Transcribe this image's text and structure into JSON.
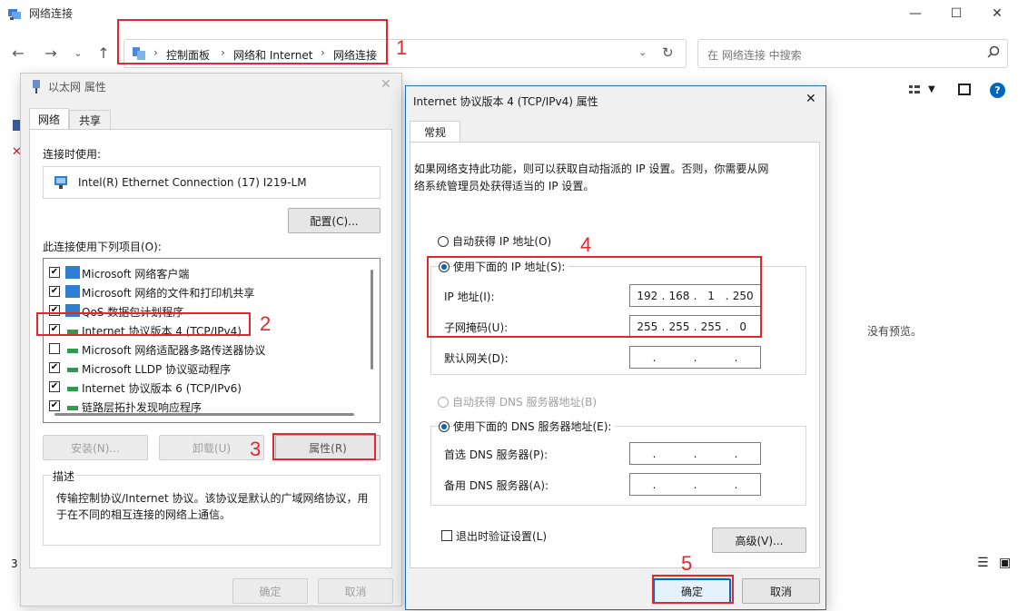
{
  "explorer": {
    "title": "网络连接",
    "controls": {
      "minimize": "—",
      "maximize": "☐",
      "close": "✕"
    },
    "breadcrumb": [
      "控制面板",
      "网络和 Internet",
      "网络连接"
    ],
    "search_placeholder": "在 网络连接 中搜索",
    "no_preview": "没有预览。",
    "status_count": "3"
  },
  "annotations": {
    "n1": "1",
    "n2": "2",
    "n3": "3",
    "n4": "4",
    "n5": "5",
    "color": "#e5262b"
  },
  "eth": {
    "title": "以太网 属性",
    "tabs": [
      "网络",
      "共享"
    ],
    "connect_using_label": "连接时使用:",
    "adapter": "Intel(R) Ethernet Connection (17) I219-LM",
    "configure": "配置(C)...",
    "items_label": "此连接使用下列项目(O):",
    "items": [
      {
        "label": "Microsoft 网络客户端",
        "checked": "✔"
      },
      {
        "label": "Microsoft 网络的文件和打印机共享",
        "checked": "✔"
      },
      {
        "label": "QoS 数据包计划程序",
        "checked": "✔"
      },
      {
        "label": "Internet 协议版本 4 (TCP/IPv4)",
        "checked": "✔"
      },
      {
        "label": "Microsoft 网络适配器多路传送器协议",
        "checked": ""
      },
      {
        "label": "Microsoft LLDP 协议驱动程序",
        "checked": "✔"
      },
      {
        "label": "Internet 协议版本 6 (TCP/IPv6)",
        "checked": "✔"
      },
      {
        "label": "链路层拓扑发现响应程序",
        "checked": "✔"
      }
    ],
    "install": "安装(N)...",
    "uninstall": "卸载(U)",
    "properties": "属性(R)",
    "desc_label": "描述",
    "desc_text": "传输控制协议/Internet 协议。该协议是默认的广域网络协议，用于在不同的相互连接的网络上通信。",
    "ok": "确定",
    "cancel": "取消"
  },
  "ipv4": {
    "title": "Internet 协议版本 4 (TCP/IPv4) 属性",
    "tab": "常规",
    "intro": "如果网络支持此功能，则可以获取自动指派的 IP 设置。否则，你需要从网络系统管理员处获得适当的 IP 设置。",
    "auto_ip": "自动获得 IP 地址(O)",
    "manual_ip": "使用下面的 IP 地址(S):",
    "ip_label": "IP 地址(I):",
    "ip_value": [
      "192",
      "168",
      "1",
      "250"
    ],
    "mask_label": "子网掩码(U):",
    "mask_value": [
      "255",
      "255",
      "255",
      "0"
    ],
    "gateway_label": "默认网关(D):",
    "auto_dns": "自动获得 DNS 服务器地址(B)",
    "manual_dns": "使用下面的 DNS 服务器地址(E):",
    "pref_dns_label": "首选 DNS 服务器(P):",
    "alt_dns_label": "备用 DNS 服务器(A):",
    "validate": "退出时验证设置(L)",
    "advanced": "高级(V)...",
    "ok": "确定",
    "cancel": "取消",
    "close": "✕"
  }
}
